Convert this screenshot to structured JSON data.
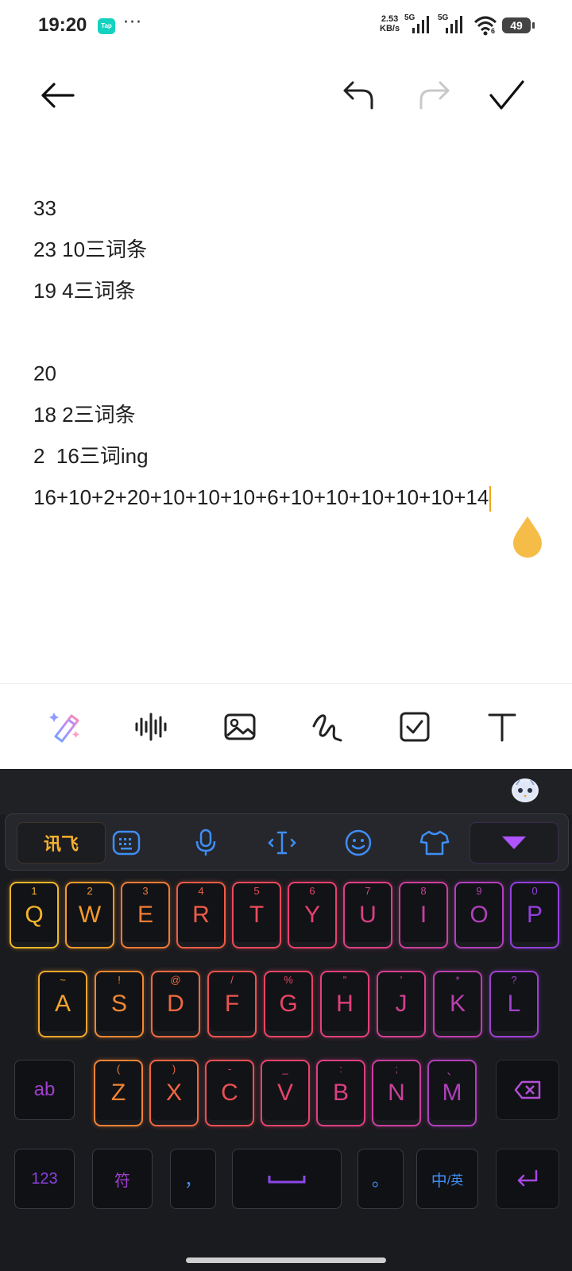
{
  "status_bar": {
    "time": "19:20",
    "tap_badge": "Tap",
    "more": "···",
    "speed_value": "2.53",
    "speed_unit": "KB/s",
    "net1": "5G",
    "net2": "5G",
    "wifi_sub": "6",
    "battery": "49"
  },
  "note": {
    "lines": [
      "33",
      "23 10三词条",
      "19 4三词条",
      "",
      "20",
      "18 2三词条",
      "2  16三词ing",
      "16+10+2+20+10+10+10+6+10+10+10+10+10+14"
    ]
  },
  "keyboard": {
    "logo": "讯飞",
    "row1": [
      {
        "k": "Q",
        "s": "1",
        "c": "#f5b52a"
      },
      {
        "k": "W",
        "s": "2",
        "c": "#f59a2b"
      },
      {
        "k": "E",
        "s": "3",
        "c": "#f27a35"
      },
      {
        "k": "R",
        "s": "4",
        "c": "#ef5c46"
      },
      {
        "k": "T",
        "s": "5",
        "c": "#ec4a5c"
      },
      {
        "k": "Y",
        "s": "6",
        "c": "#e8406f"
      },
      {
        "k": "U",
        "s": "7",
        "c": "#de3f86"
      },
      {
        "k": "I",
        "s": "8",
        "c": "#cc3f9e"
      },
      {
        "k": "O",
        "s": "9",
        "c": "#b23fbd"
      },
      {
        "k": "P",
        "s": "0",
        "c": "#9340de"
      }
    ],
    "row2": [
      {
        "k": "A",
        "s": "~",
        "c": "#f5a52b"
      },
      {
        "k": "S",
        "s": "!",
        "c": "#f28733"
      },
      {
        "k": "D",
        "s": "@",
        "c": "#ef6a40"
      },
      {
        "k": "F",
        "s": "/",
        "c": "#ec5252"
      },
      {
        "k": "G",
        "s": "%",
        "c": "#e84566"
      },
      {
        "k": "H",
        "s": "\"",
        "c": "#e23f7b"
      },
      {
        "k": "J",
        "s": "'",
        "c": "#d43f91"
      },
      {
        "k": "K",
        "s": "*",
        "c": "#bd3fae"
      },
      {
        "k": "L",
        "s": "?",
        "c": "#9f40d1"
      }
    ],
    "row3": [
      {
        "k": "Z",
        "s": "(",
        "c": "#f28335"
      },
      {
        "k": "X",
        "s": ")",
        "c": "#ef6642"
      },
      {
        "k": "C",
        "s": "-",
        "c": "#eb4f56"
      },
      {
        "k": "V",
        "s": "_",
        "c": "#e6436c"
      },
      {
        "k": "B",
        "s": ":",
        "c": "#dc3f83"
      },
      {
        "k": "N",
        "s": ";",
        "c": "#ca3f9c"
      },
      {
        "k": "M",
        "s": "、",
        "c": "#b03fbb"
      }
    ],
    "ab": "ab",
    "num": "123",
    "sym": "符",
    "comma": "，",
    "period": "。",
    "lang_zh": "中",
    "lang_en": "/英"
  }
}
